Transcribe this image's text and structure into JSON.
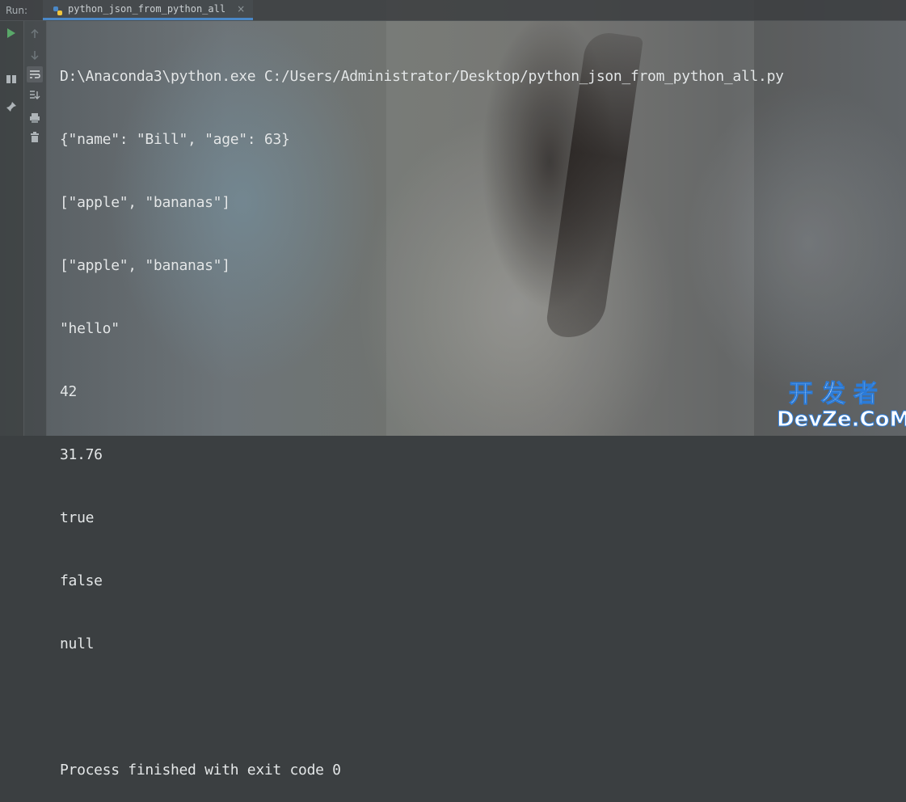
{
  "run_panel": {
    "label": "Run:",
    "active_tab": {
      "label": "python_json_from_python_all",
      "icon": "python-file-icon",
      "close": "×"
    }
  },
  "toolbar": {
    "buttons": [
      {
        "name": "rerun-icon",
        "color": "#59a869"
      },
      {
        "name": "arrow-up-icon"
      },
      {
        "name": "arrow-down-icon"
      },
      {
        "name": "layout-icon"
      },
      {
        "name": "soft-wrap-icon"
      },
      {
        "name": "scroll-to-end-icon"
      },
      {
        "name": "pin-icon"
      },
      {
        "name": "print-icon"
      },
      {
        "name": "trash-icon"
      }
    ]
  },
  "console": {
    "lines": [
      "D:\\Anaconda3\\python.exe C:/Users/Administrator/Desktop/python_json_from_python_all.py",
      "{\"name\": \"Bill\", \"age\": 63}",
      "[\"apple\", \"bananas\"]",
      "[\"apple\", \"bananas\"]",
      "\"hello\"",
      "42",
      "31.76",
      "true",
      "false",
      "null",
      "",
      "Process finished with exit code 0"
    ]
  },
  "watermark": {
    "chinese": "开发者",
    "english": "DevZe.CoM",
    "color": "#2b7bd8"
  }
}
